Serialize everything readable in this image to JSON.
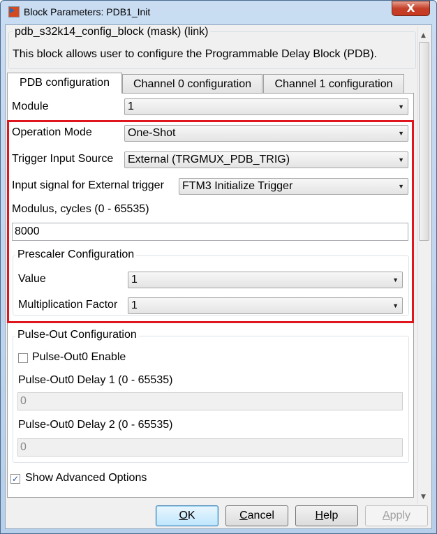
{
  "window": {
    "title": "Block Parameters: PDB1_Init",
    "close": "X"
  },
  "mask": {
    "title": "pdb_s32k14_config_block (mask) (link)",
    "description": "This block allows user to configure the Programmable Delay Block (PDB)."
  },
  "tabs": [
    {
      "label": "PDB configuration",
      "active": true
    },
    {
      "label": "Channel 0 configuration"
    },
    {
      "label": "Channel 1 configuration"
    }
  ],
  "fields": {
    "module": {
      "label": "Module",
      "value": "1"
    },
    "operation_mode": {
      "label": "Operation Mode",
      "value": "One-Shot"
    },
    "trigger_input_source": {
      "label": "Trigger Input Source",
      "value": "External (TRGMUX_PDB_TRIG)"
    },
    "external_trigger": {
      "label": "Input signal for External trigger",
      "value": "FTM3 Initialize Trigger"
    },
    "modulus": {
      "label": "Modulus, cycles (0 - 65535)",
      "value": "8000"
    }
  },
  "prescaler": {
    "title": "Prescaler Configuration",
    "value": {
      "label": "Value",
      "value": "1"
    },
    "multiplication_factor": {
      "label": "Multiplication Factor",
      "value": "1"
    }
  },
  "pulse_out": {
    "title": "Pulse-Out Configuration",
    "enable": {
      "label": "Pulse-Out0 Enable",
      "checked": false
    },
    "delay1": {
      "label": "Pulse-Out0 Delay 1 (0 - 65535)",
      "value": "0"
    },
    "delay2": {
      "label": "Pulse-Out0 Delay 2 (0 - 65535)",
      "value": "0"
    }
  },
  "show_advanced": {
    "label": "Show Advanced Options",
    "checked": true,
    "mark": "✓"
  },
  "buttons": {
    "ok": {
      "u": "O",
      "rest": "K"
    },
    "cancel": {
      "u": "C",
      "rest": "ancel"
    },
    "help": {
      "u": "H",
      "rest": "elp"
    },
    "apply": {
      "u": "A",
      "rest": "pply"
    }
  },
  "highlight_color": "#e0161e"
}
